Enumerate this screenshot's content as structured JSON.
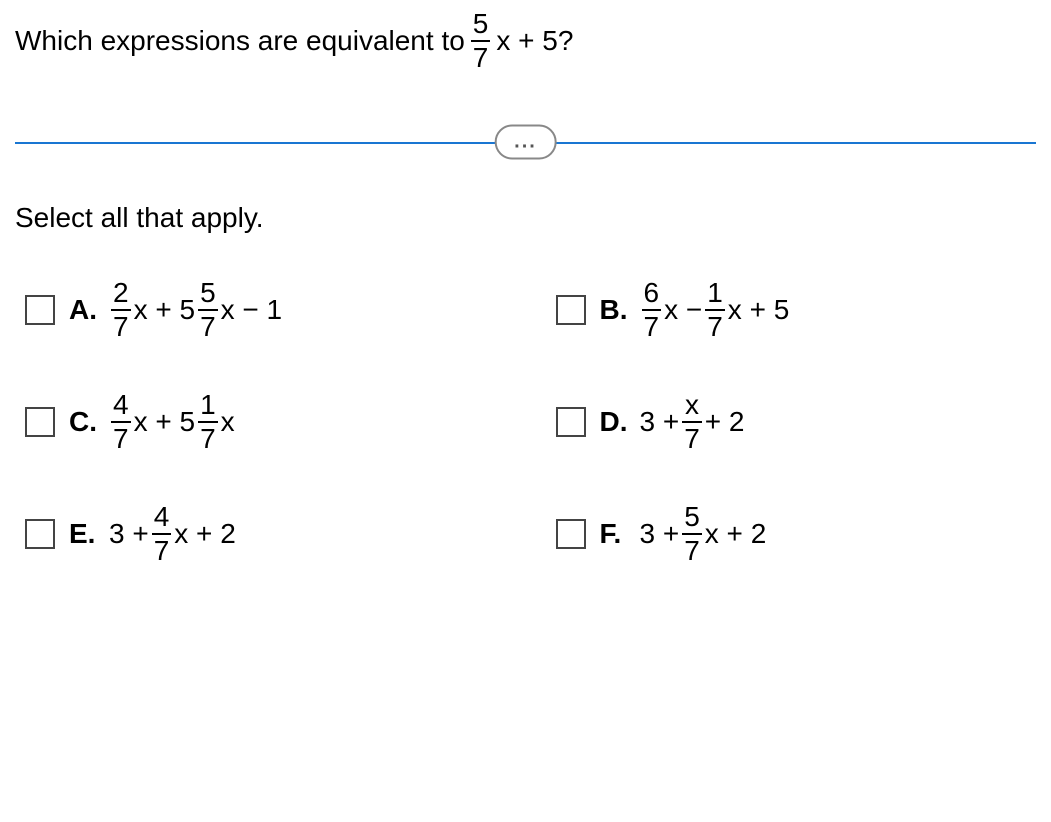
{
  "question": {
    "pre": "Which expressions are equivalent to",
    "frac_num": "5",
    "frac_den": "7",
    "post": "x + 5?"
  },
  "divider": "...",
  "instruction": "Select all that apply.",
  "options": {
    "A": {
      "label": "A.",
      "parts": [
        {
          "type": "frac",
          "num": "2",
          "den": "7"
        },
        {
          "type": "text",
          "v": "x + 5"
        },
        {
          "type": "frac",
          "num": "5",
          "den": "7"
        },
        {
          "type": "text",
          "v": "x − 1"
        }
      ]
    },
    "B": {
      "label": "B.",
      "parts": [
        {
          "type": "frac",
          "num": "6",
          "den": "7"
        },
        {
          "type": "text",
          "v": "x −"
        },
        {
          "type": "frac",
          "num": "1",
          "den": "7"
        },
        {
          "type": "text",
          "v": "x + 5"
        }
      ]
    },
    "C": {
      "label": "C.",
      "parts": [
        {
          "type": "frac",
          "num": "4",
          "den": "7"
        },
        {
          "type": "text",
          "v": "x + 5"
        },
        {
          "type": "frac",
          "num": "1",
          "den": "7"
        },
        {
          "type": "text",
          "v": "x"
        }
      ]
    },
    "D": {
      "label": "D.",
      "parts": [
        {
          "type": "text",
          "v": "3 +"
        },
        {
          "type": "frac",
          "num": "x",
          "den": "7"
        },
        {
          "type": "text",
          "v": "+ 2"
        }
      ]
    },
    "E": {
      "label": "E.",
      "parts": [
        {
          "type": "text",
          "v": "3 +"
        },
        {
          "type": "frac",
          "num": "4",
          "den": "7"
        },
        {
          "type": "text",
          "v": "x + 2"
        }
      ]
    },
    "F": {
      "label": "F.",
      "parts": [
        {
          "type": "text",
          "v": "3 +"
        },
        {
          "type": "frac",
          "num": "5",
          "den": "7"
        },
        {
          "type": "text",
          "v": "x + 2"
        }
      ]
    }
  }
}
